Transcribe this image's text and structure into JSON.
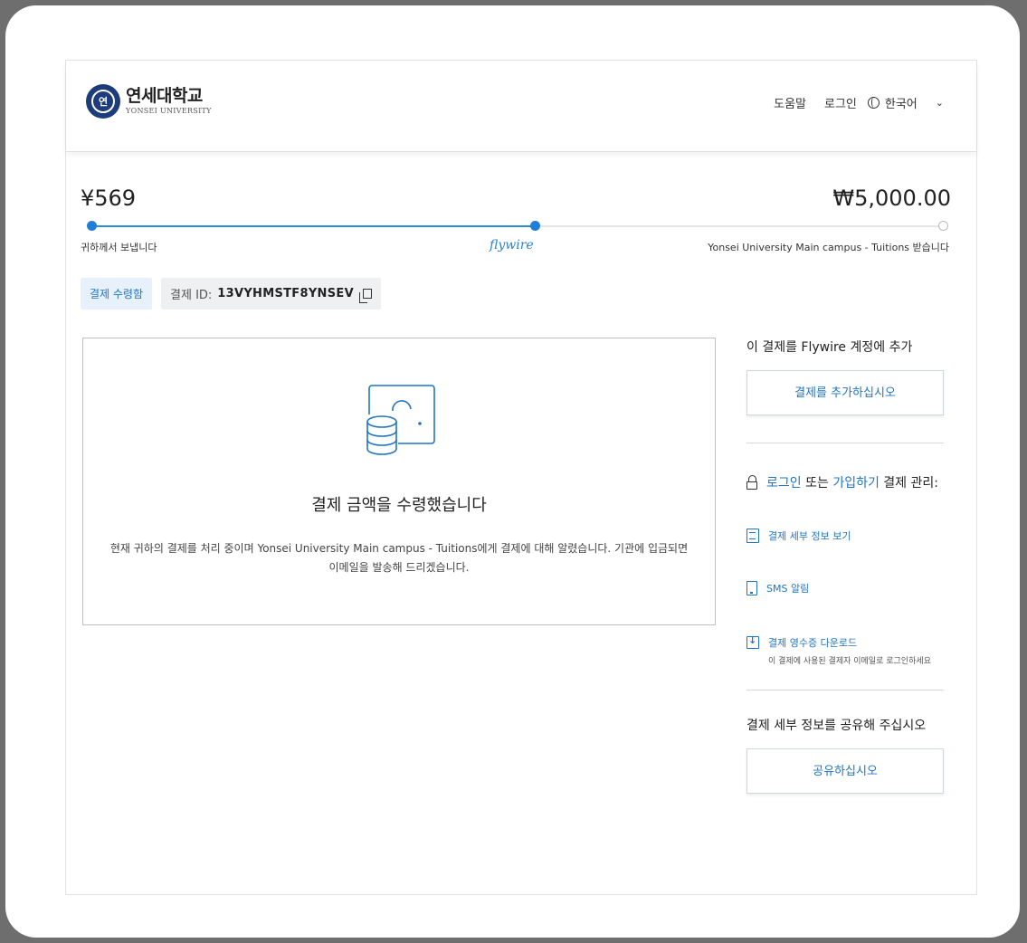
{
  "header": {
    "logo_seal_text": "연",
    "logo_korean": "연세대학교",
    "logo_english": "YONSEI UNIVERSITY",
    "nav": {
      "help": "도움말",
      "login": "로그인",
      "language": "한국어"
    }
  },
  "transfer": {
    "send_amount": "¥569",
    "receive_amount": "₩5,000.00",
    "sender_label": "귀하께서 보냅니다",
    "provider_label": "flywire",
    "receiver_label": "Yonsei University Main campus - Tuitions 받습니다",
    "progress": 0.52
  },
  "status": {
    "badge": "결제 수령함",
    "payment_id_label": "결제 ID:",
    "payment_id": "13VYHMSTF8YNSEV"
  },
  "main": {
    "title": "결제 금액을 수령했습니다",
    "description": "현재 귀하의 결제를 처리 중이며 Yonsei University Main campus - Tuitions에게 결제에 대해 알렸습니다. 기관에 입금되면 이메일을 발송해 드리겠습니다."
  },
  "sidebar": {
    "add_heading": "이 결제를 Flywire 계정에 추가",
    "add_button": "결제를 추가하십시오",
    "login_link": "로그인",
    "or_text": " 또는 ",
    "signup_link": "가입하기",
    "manage_text": " 결제 관리:",
    "actions": {
      "details": "결제 세부 정보 보기",
      "sms": "SMS 알림",
      "receipt": "결제 영수증 다운로드",
      "receipt_note": "이 결제에 사용된 결제자 이메일로 로그인하세요"
    },
    "share_heading": "결제 세부 정보를 공유해 주십시오",
    "share_button": "공유하십시오"
  },
  "colors": {
    "accent": "#1f74c4",
    "badge_bg": "#e6f1fb",
    "seal": "#1d3c7a"
  }
}
